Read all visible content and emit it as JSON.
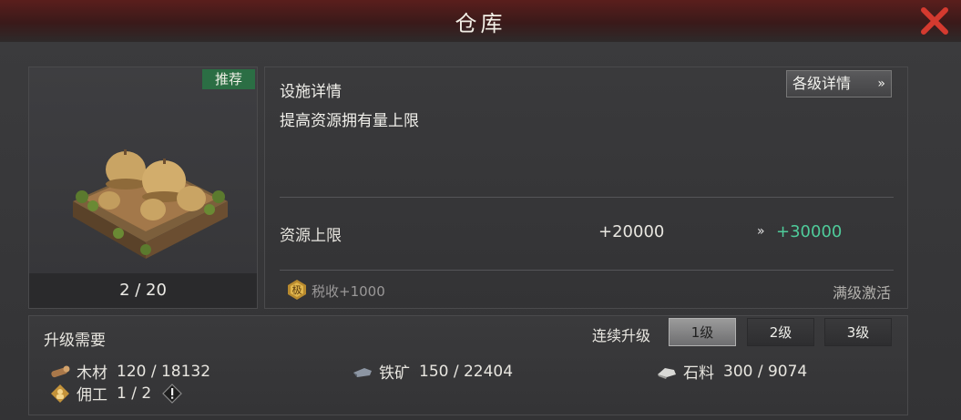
{
  "window": {
    "title": "仓库"
  },
  "building": {
    "badge": "推荐",
    "level_text": "2 / 20"
  },
  "details": {
    "heading": "设施详情",
    "levels_button": "各级详情",
    "description": "提高资源拥有量上限",
    "stat": {
      "label": "资源上限",
      "current": "+20000",
      "next": "+30000"
    },
    "tax_text": "税收+1000",
    "max_text": "满级激活"
  },
  "requirements": {
    "title": "升级需要",
    "continuous_label": "连续升级",
    "level_buttons": [
      "1级",
      "2级",
      "3级"
    ],
    "selected_level_index": 0,
    "resources": [
      {
        "icon": "wood-icon",
        "label": "木材",
        "value": "120 / 18132"
      },
      {
        "icon": "iron-ore-icon",
        "label": "铁矿",
        "value": "150 / 22404"
      },
      {
        "icon": "stone-icon",
        "label": "石料",
        "value": "300 / 9074"
      },
      {
        "icon": "worker-icon",
        "label": "佣工",
        "value": "1 / 2"
      }
    ]
  },
  "colors": {
    "accent_green": "#4fcb9a",
    "badge_green": "#2b6e44",
    "close_red": "#d43a2f"
  }
}
